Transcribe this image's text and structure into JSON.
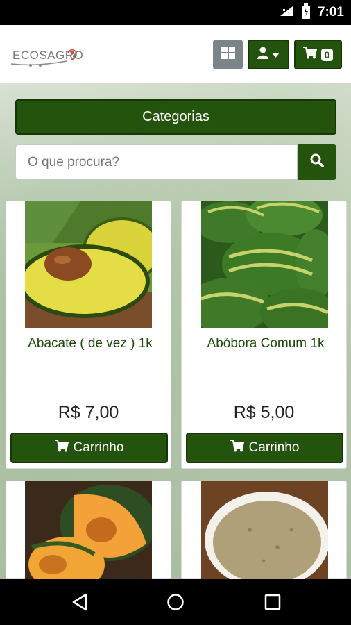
{
  "status_bar": {
    "time": "7:01"
  },
  "header": {
    "logo_text": "ECOSAGRO",
    "cart_count": "0"
  },
  "nav": {
    "categories_label": "Categorias",
    "search_placeholder": "O que procura?"
  },
  "products": [
    {
      "name": "Abacate ( de vez ) 1k",
      "price": "R$ 7,00",
      "button_label": "Carrinho"
    },
    {
      "name": "Abóbora Comum 1k",
      "price": "R$ 5,00",
      "button_label": "Carrinho"
    },
    {
      "name": "",
      "price": "",
      "button_label": ""
    },
    {
      "name": "",
      "price": "",
      "button_label": ""
    }
  ],
  "colors": {
    "primary": "#24530e",
    "gray_button": "#7b8489",
    "product_name": "#1d4a0a"
  },
  "icons": [
    "signal-icon",
    "battery-icon",
    "grid-view-icon",
    "user-icon",
    "caret-down-icon",
    "cart-icon",
    "search-icon",
    "back-icon",
    "home-icon",
    "recents-icon"
  ]
}
